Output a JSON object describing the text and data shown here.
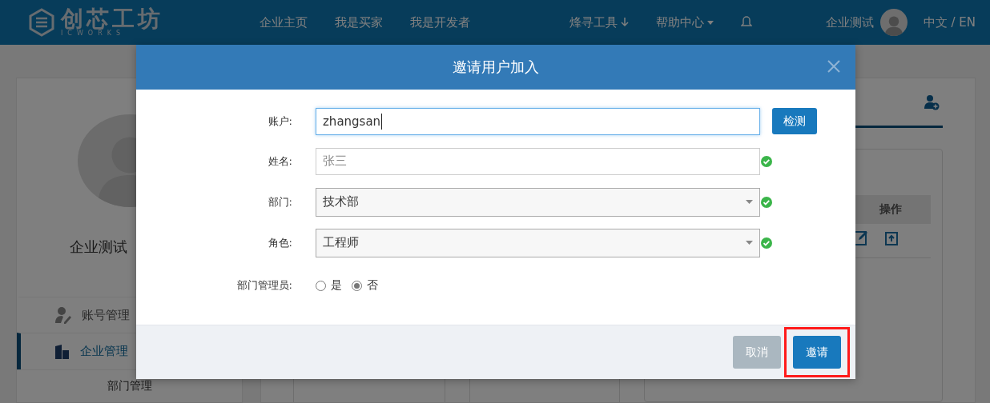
{
  "header": {
    "logo": {
      "name": "创芯工坊",
      "subtitle": "ICWORKS"
    },
    "nav": [
      {
        "label": "企业主页",
        "kind": "plain"
      },
      {
        "label": "我是买家",
        "kind": "plain"
      },
      {
        "label": "我是开发者",
        "kind": "plain"
      },
      {
        "label": "烽寻工具",
        "kind": "download"
      },
      {
        "label": "帮助中心",
        "kind": "dropdown"
      }
    ],
    "user": "企业测试",
    "language": "中文 / EN"
  },
  "sidebar": {
    "profile_name": "企业测试",
    "items": [
      {
        "label": "账号管理",
        "kind": "account",
        "selected": false
      },
      {
        "label": "企业管理",
        "kind": "company",
        "selected": true,
        "children": [
          {
            "label": "部门管理"
          }
        ]
      }
    ]
  },
  "content": {
    "table": {
      "columns": [
        "操作"
      ]
    }
  },
  "dialog": {
    "title": "邀请用户加入",
    "fields": [
      {
        "label": "账户:",
        "kind": "input",
        "value": "zhangsan",
        "focused": true,
        "valid": false,
        "action": "检测"
      },
      {
        "label": "姓名:",
        "kind": "input",
        "placeholder": "张三",
        "focused": false,
        "valid": true
      },
      {
        "label": "部门:",
        "kind": "select",
        "value": "技术部",
        "valid": true
      },
      {
        "label": "角色:",
        "kind": "select",
        "value": "工程师",
        "valid": true
      }
    ],
    "radio_group": {
      "label": "部门管理员:",
      "options": [
        {
          "label": "是",
          "selected": false
        },
        {
          "label": "否",
          "selected": true
        }
      ]
    },
    "buttons": [
      {
        "label": "取消",
        "kind": "cancel",
        "highlighted": false
      },
      {
        "label": "邀请",
        "kind": "primary",
        "highlighted": true
      }
    ]
  }
}
